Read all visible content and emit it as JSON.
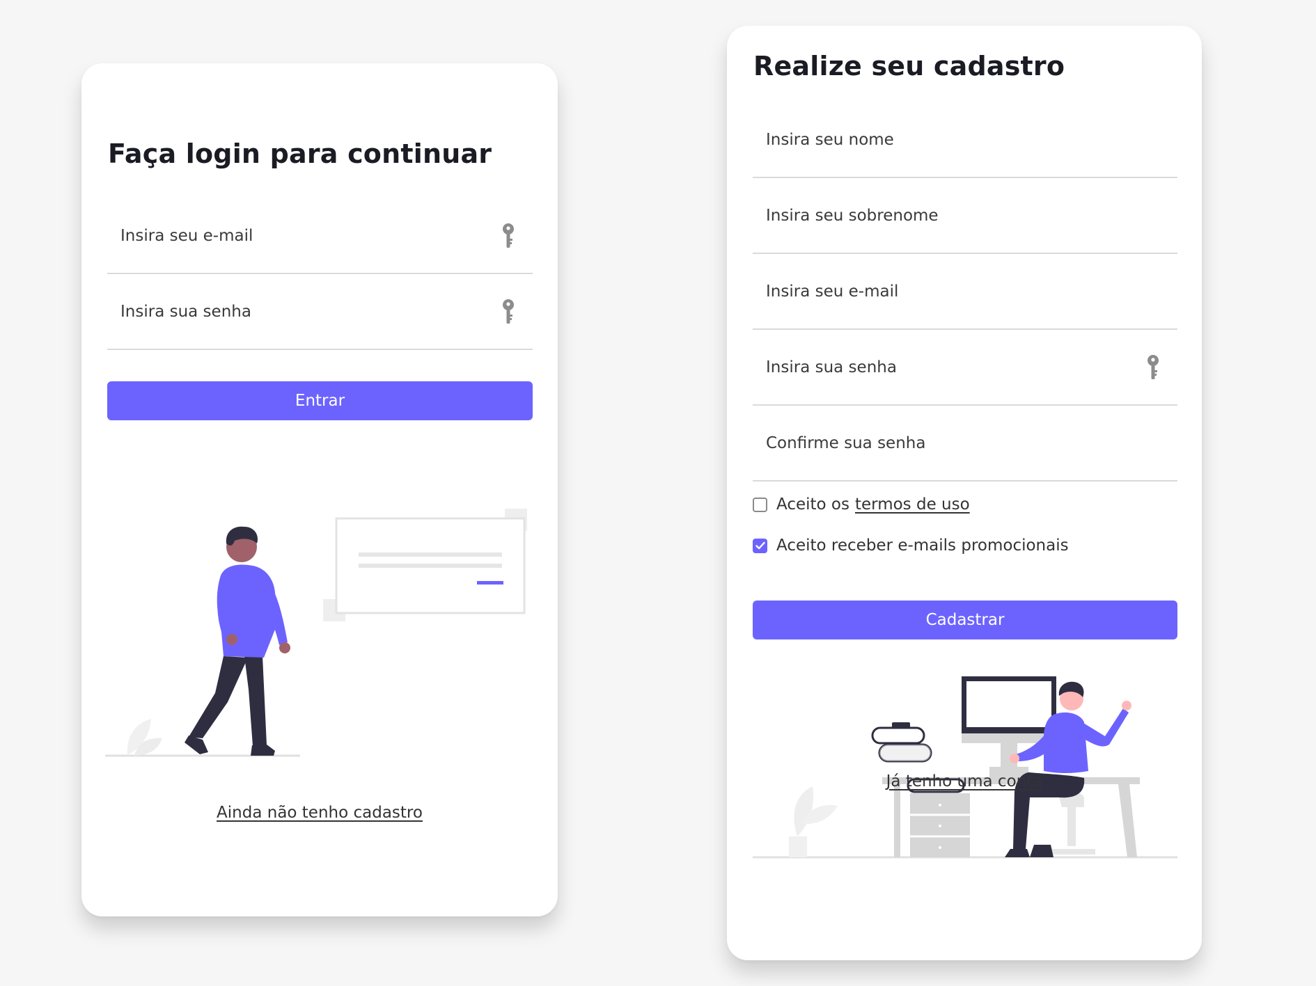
{
  "colors": {
    "accent": "#6c63ff",
    "background": "#f6f6f6",
    "card": "#ffffff",
    "divider": "#dadada",
    "dark_figure": "#2f2e41",
    "skin": "#a0616a"
  },
  "login": {
    "title": "Faça login para continuar",
    "email_placeholder": "Insira seu e-mail",
    "password_placeholder": "Insira sua senha",
    "field_icon": "key-icon",
    "submit_label": "Entrar",
    "register_link": "Ainda não tenho cadastro"
  },
  "signup": {
    "title": "Realize seu cadastro",
    "first_name_placeholder": "Insira seu nome",
    "last_name_placeholder": "Insira seu sobrenome",
    "email_placeholder": "Insira seu e-mail",
    "password_placeholder": "Insira sua senha",
    "confirm_password_placeholder": "Confirme sua senha",
    "password_icon": "key-icon",
    "terms_prefix": "Aceito os",
    "terms_link": "termos de uso",
    "terms_checked": false,
    "promo_label": "Aceito receber e-mails promocionais",
    "promo_checked": true,
    "submit_label": "Cadastrar",
    "login_link": "Já tenho uma conta"
  }
}
